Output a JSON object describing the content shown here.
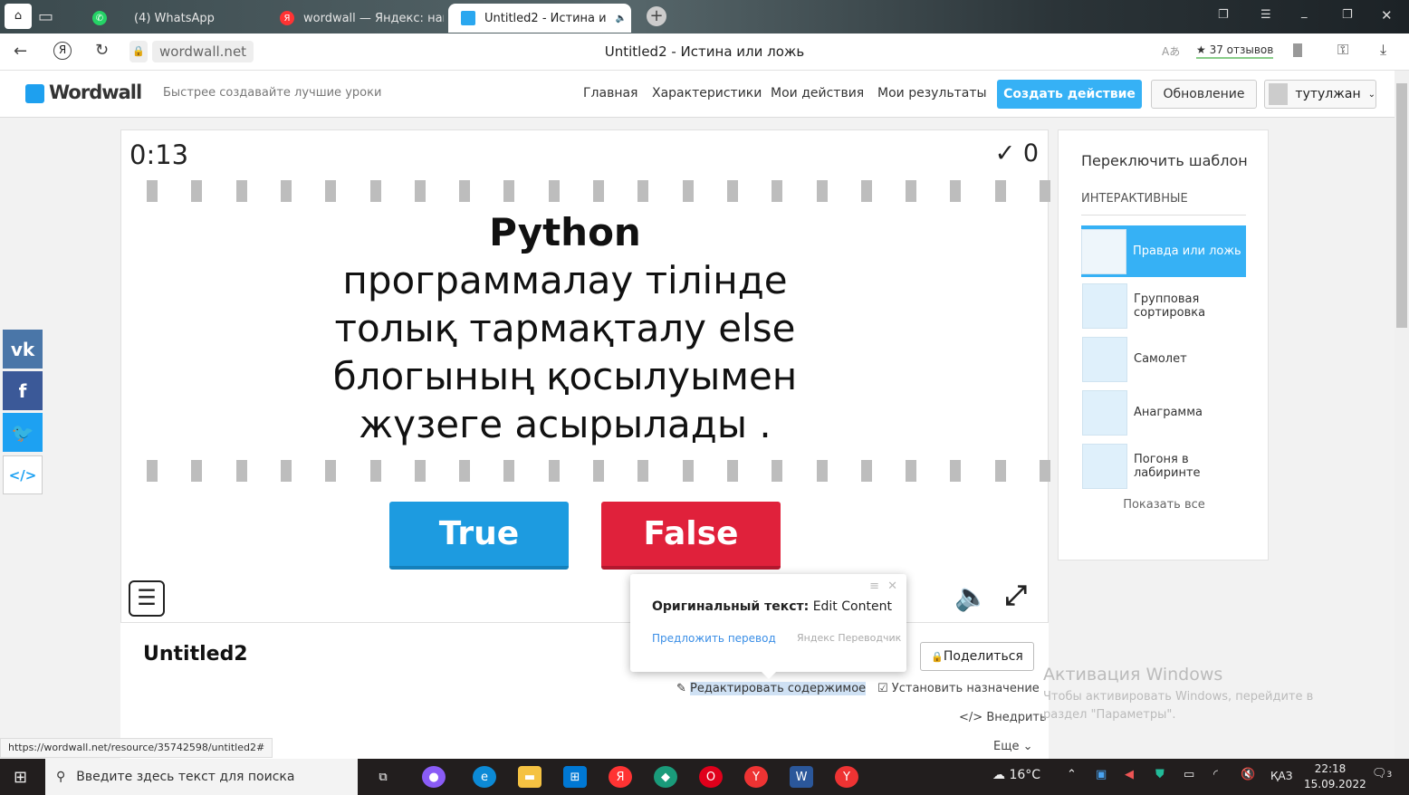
{
  "browser": {
    "tabs": [
      {
        "label": "(4) WhatsApp"
      },
      {
        "label": "wordwall — Яндекс: нашла"
      },
      {
        "label": "Untitled2 - Истина и"
      }
    ],
    "url": "wordwall.net",
    "page_title": "Untitled2 - Истина или ложь",
    "reviews": "★ 37 отзывов",
    "status_url": "https://wordwall.net/resource/35742598/untitled2#"
  },
  "site": {
    "logo": "Wordwall",
    "tagline": "Быстрее создавайте лучшие уроки",
    "nav": [
      "Главная",
      "Характеристики",
      "Мои действия",
      "Мои результаты"
    ],
    "create_label": "Создать действие",
    "upgrade_label": "Обновление",
    "user": "тутулжан"
  },
  "game": {
    "timer": "0:13",
    "score_icon": "✓",
    "score": "0",
    "question": [
      "Python",
      "программалау  тілінде",
      "толық  тармақталу  else",
      "блогының  қосылуымен",
      "жүзеге  асырылады ."
    ],
    "true_label": "True",
    "false_label": "False",
    "colors": {
      "true": "#1d9be0",
      "false": "#e0213b"
    }
  },
  "activity": {
    "title": "Untitled2",
    "share_label": "Поделиться",
    "edit_label": "Редактировать содержимое",
    "assign_label": "Установить назначение",
    "embed_label": "Внедрить",
    "more_label": "Еще"
  },
  "translate_popup": {
    "original_prefix": "Оригинальный текст:",
    "original_text": "Edit Content",
    "suggest": "Предложить перевод",
    "brand": "Яндекс Переводчик"
  },
  "sidebar": {
    "title": "Переключить шаблон",
    "section": "ИНТЕРАКТИВНЫЕ",
    "templates": [
      "Правда или ложь",
      "Групповая сортировка",
      "Самолет",
      "Анаграмма",
      "Погоня в лабиринте"
    ],
    "show_all": "Показать все"
  },
  "watermark": {
    "title": "Активация Windows",
    "text": "Чтобы активировать Windows, перейдите в раздел \"Параметры\"."
  },
  "taskbar": {
    "search": "Введите здесь текст для поиска",
    "weather": "16°C",
    "lang": "ҚАЗ",
    "time": "22:18",
    "date": "15.09.2022",
    "notifications": "3"
  }
}
